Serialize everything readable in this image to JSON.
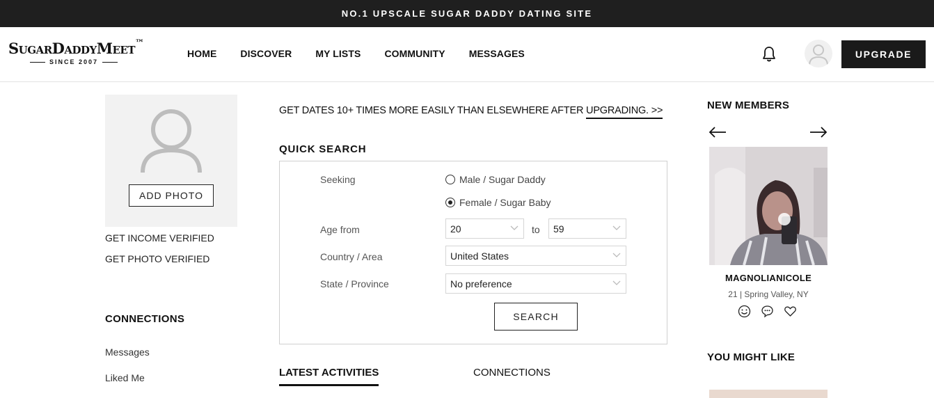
{
  "banner": {
    "text": "NO.1 UPSCALE SUGAR DADDY DATING SITE"
  },
  "logo": {
    "main": "SugarDaddyMeet",
    "tm": "™",
    "sub": "SINCE 2007"
  },
  "nav": {
    "items": [
      {
        "label": "HOME"
      },
      {
        "label": "DISCOVER"
      },
      {
        "label": "MY LISTS"
      },
      {
        "label": "COMMUNITY"
      },
      {
        "label": "MESSAGES"
      }
    ],
    "upgrade_label": "UPGRADE",
    "icons": [
      "bell-icon",
      "user-avatar-icon"
    ]
  },
  "profile": {
    "add_photo_label": "ADD PHOTO",
    "links": [
      "GET INCOME VERIFIED",
      "GET PHOTO VERIFIED"
    ]
  },
  "connections": {
    "heading": "CONNECTIONS",
    "items": [
      "Messages",
      "Liked Me"
    ]
  },
  "promo": {
    "text": "GET DATES 10+ TIMES MORE EASILY THAN ELSEWHERE AFTER ",
    "link": "UPGRADING. >>"
  },
  "quick_search": {
    "title": "QUICK SEARCH",
    "seeking_label": "Seeking",
    "options": [
      {
        "label": "Male / Sugar Daddy",
        "selected": false
      },
      {
        "label": "Female / Sugar Baby",
        "selected": true
      }
    ],
    "age_label": "Age from",
    "age_from": "20",
    "age_to_label": "to",
    "age_to": "59",
    "country_label": "Country / Area",
    "country_value": "United States",
    "state_label": "State / Province",
    "state_value": "No preference",
    "search_label": "SEARCH"
  },
  "tabs": [
    {
      "label": "LATEST ACTIVITIES",
      "active": true
    },
    {
      "label": "CONNECTIONS",
      "active": false
    }
  ],
  "new_members": {
    "heading": "NEW MEMBERS",
    "member": {
      "name": "MAGNOLIANICOLE",
      "info": "21 | Spring Valley, NY"
    },
    "actions": [
      "smile-icon",
      "chat-icon",
      "heart-icon"
    ]
  },
  "you_might_like": {
    "heading": "YOU MIGHT LIKE"
  },
  "colors": {
    "dark": "#1f1f1f",
    "border": "#cfcfcf",
    "photo_bg": "#f2f2f2"
  }
}
